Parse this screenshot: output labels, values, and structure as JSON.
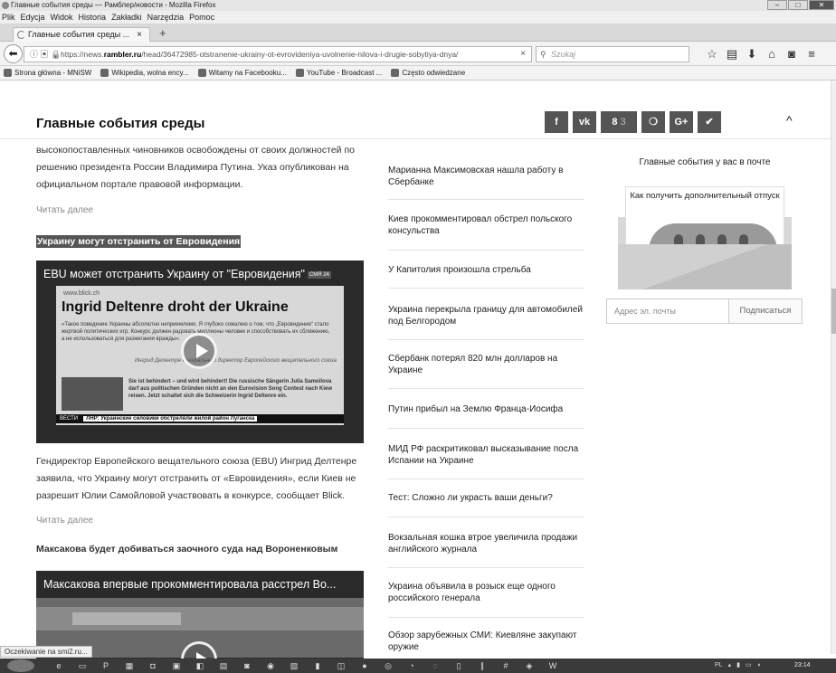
{
  "window": {
    "title": "Главные события среды — Рамблер/новости - Mozilla Firefox",
    "buttons": [
      "–",
      "□",
      "✕"
    ]
  },
  "menu": [
    "Plik",
    "Edycja",
    "Widok",
    "Historia",
    "Zakładki",
    "Narzędzia",
    "Pomoc"
  ],
  "tab": {
    "label": "Главные события среды ...",
    "close": "×",
    "new": "+"
  },
  "address": {
    "prefix": "https://news.",
    "host": "rambler.ru",
    "path": "/head/36472985-otstranenie-ukrainy-ot-evrovideniya-uvolnenie-nilova-i-drugie-sobytiya-dnya/",
    "clear": "×"
  },
  "search": {
    "placeholder": "Szukaj"
  },
  "bookmarks": [
    "Strona główna - MNiSW",
    "Wikipedia, wolna ency...",
    "Witamy na Facebooku...",
    "YouTube - Broadcast ...",
    "Często odwiedzane"
  ],
  "site": {
    "title": "Главные события среды",
    "share": {
      "fb": "f",
      "vk": "vk",
      "ok": "8",
      "ok_count": "3",
      "lj": "❍",
      "gplus": "G+",
      "tw": "✔",
      "collapse": "^"
    }
  },
  "article": {
    "intro": "высокопоставленных чиновников освобождены от своих должностей по решению президента России Владимира Путина. Указ опубликован на официальном портале правовой информации.",
    "read_more_1": "Читать далее",
    "headline_1": "Украину могут отстранить от Евровидения",
    "video_1": {
      "title": "EBU может отстранить Украину от \"Евровидения\"",
      "badge": "СМЯ 24",
      "url": "www.blick.ch",
      "head": "Ingrid Deltenre droht der Ukraine",
      "quote": "«Такое поведение Украины абсолютно неприемлемо. Я глубоко сожалею о том, что „Евровидение“ стало жертвой политических игр. Конкурс должен радовать миллионы человек и способствовать их сближению, а не использоваться для разжигания вражды».",
      "sign": "Ингрид Делентре Генеральный директор Европейского вещательного союза",
      "de_text": "Sie ist behindert – und wird behindert! Die russische Sängerin Julia Samoilova darf aus politischen Gründen nicht an den Eurovision Song Contest nach Kiew reisen. Jetzt schaltet sich die Schweizerin Ingrid Deltenre ein.",
      "bar_left": "ВЕСТИ",
      "bar_text": "ЛНР: Украинские силовики обстреляли жилой район Луганска"
    },
    "body_2": "Гендиректор Европейского вещательного союза (EBU) Ингрид Делтенре заявила, что Украину могут отстранить от «Евровидения», если Киев не разрешит Юлии Самойловой участвовать в конкурсе, сообщает Blick.",
    "read_more_2": "Читать далее",
    "headline_2": "Максакова будет добиваться заочного суда над Вороненковым",
    "video_2": {
      "title": "Максакова впервые прокомментировала расстрел Во..."
    }
  },
  "news": [
    "Марианна Максимовская нашла работу в Сбербанке",
    "Киев прокомментировал обстрел польского консульства",
    "У Капитолия произошла стрельба",
    "Украина перекрыла границу для автомобилей под Белгородом",
    "Сбербанк потерял 820 млн долларов на Украине",
    "Путин прибыл на Землю Франца-Иосифа",
    "МИД РФ раскритиковал высказывание посла Испании на Украине",
    "Тест: Сложно ли украсть ваши деньги?",
    "Вокзальная кошка втрое увеличила продажи английского журнала",
    "Украина объявила в розыск еще одного российского генерала",
    "Обзор зарубежных СМИ: Киевляне закупают оружие"
  ],
  "newsletter": {
    "title": "Главные события у вас в почте",
    "card": "Как получить дополнительный отпуск",
    "email_placeholder": "Адрес эл. почты",
    "subscribe": "Подписаться"
  },
  "status": "Oczekiwanie na smi2.ru...",
  "taskbar": {
    "lang": "PL",
    "clock": "23:14"
  }
}
